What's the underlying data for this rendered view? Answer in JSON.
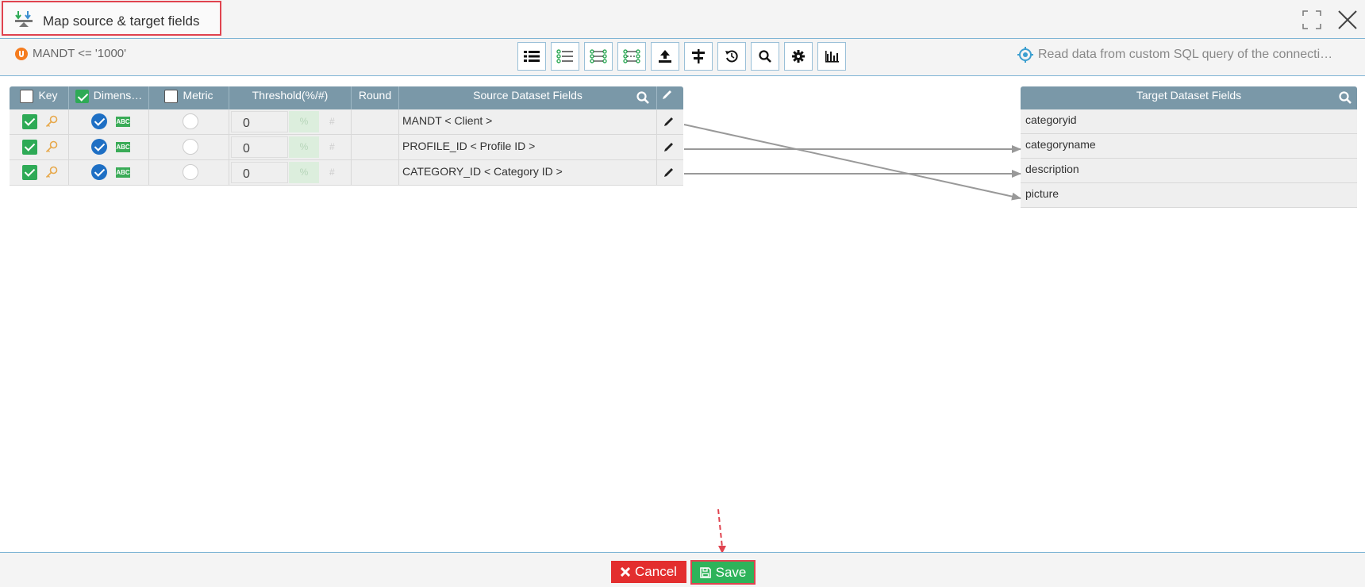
{
  "window": {
    "title": "Map source & target fields"
  },
  "toolbar": {
    "filter_text": "MANDT <= '1000'",
    "info_text": "Read data from custom SQL query of the connecti…",
    "tools": [
      "list-icon",
      "list-check-icon",
      "link-all-icon",
      "link-some-icon",
      "upload-icon",
      "split-icon",
      "reset-icon",
      "search-icon",
      "gear-icon",
      "bar-chart-icon"
    ]
  },
  "source_table": {
    "columns": {
      "key": "Key",
      "dimension": "Dimens…",
      "metric": "Metric",
      "threshold": "Threshold(%/#)",
      "round": "Round",
      "fields": "Source Dataset Fields"
    },
    "threshold_pct": "%",
    "threshold_hash": "#",
    "rows": [
      {
        "threshold": "0",
        "field": "MANDT < Client >"
      },
      {
        "threshold": "0",
        "field": "PROFILE_ID < Profile ID >"
      },
      {
        "threshold": "0",
        "field": "CATEGORY_ID < Category ID >"
      }
    ]
  },
  "target_table": {
    "header": "Target Dataset Fields",
    "rows": [
      "categoryid",
      "categoryname",
      "description",
      "picture"
    ]
  },
  "mappings": [
    {
      "source": 0,
      "target": 3
    },
    {
      "source": 1,
      "target": 1
    },
    {
      "source": 2,
      "target": 2
    }
  ],
  "footer": {
    "cancel_label": "Cancel",
    "save_label": "Save"
  },
  "colors": {
    "header_bg": "#7a98a8",
    "accent_blue": "#7fb5d5",
    "cancel": "#e32e2e",
    "save": "#2eb35a",
    "highlight": "#e0434f"
  }
}
